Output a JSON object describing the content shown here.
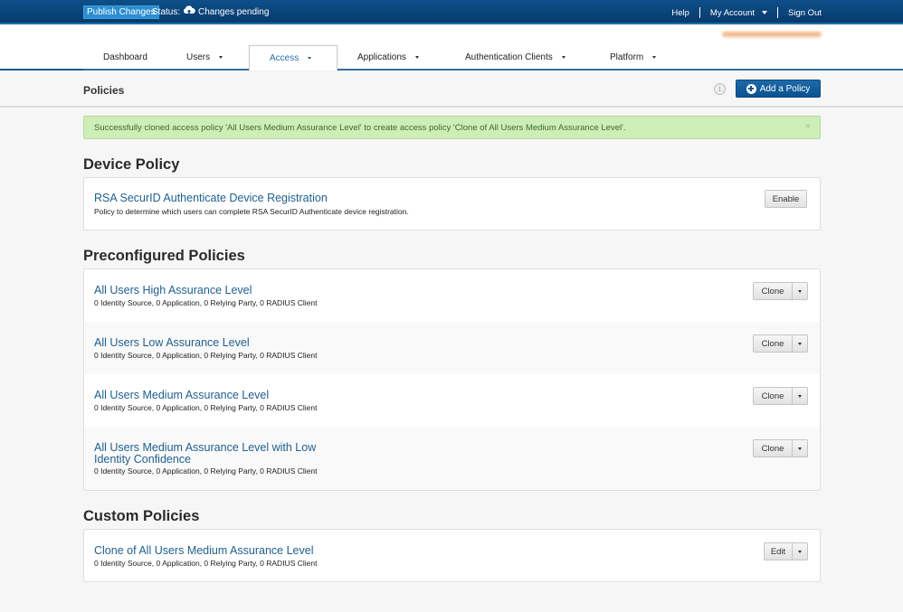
{
  "topbar": {
    "publish_label": "Publish Changes",
    "status_label": "Status:",
    "status_icon": "cloud-upload-icon",
    "status_text": "Changes pending",
    "links": {
      "help": "Help",
      "my_account": "My Account",
      "sign_out": "Sign Out"
    }
  },
  "nav": {
    "tabs": [
      {
        "label": "Dashboard",
        "has_dropdown": false
      },
      {
        "label": "Users",
        "has_dropdown": true
      },
      {
        "label": "Access",
        "has_dropdown": true,
        "active": true
      },
      {
        "label": "Applications",
        "has_dropdown": true
      },
      {
        "label": "Authentication Clients",
        "has_dropdown": true
      },
      {
        "label": "Platform",
        "has_dropdown": true
      }
    ]
  },
  "subheader": {
    "title": "Policies",
    "info_icon": "i",
    "add_button": "Add a Policy"
  },
  "alert": {
    "message": "Successfully cloned access policy 'All Users Medium Assurance Level' to create access policy 'Clone of All Users Medium Assurance Level'.",
    "close": "×"
  },
  "sections": {
    "device": {
      "title": "Device Policy",
      "items": [
        {
          "name": "RSA SecurID Authenticate Device Registration",
          "description": "Policy to determine which users can complete RSA SecurID Authenticate device registration.",
          "action": "Enable"
        }
      ]
    },
    "preconfigured": {
      "title": "Preconfigured Policies",
      "items": [
        {
          "name": "All Users High Assurance Level",
          "description": "0 Identity Source, 0 Application, 0 Relying Party, 0 RADIUS Client",
          "action": "Clone"
        },
        {
          "name": "All Users Low Assurance Level",
          "description": "0 Identity Source, 0 Application, 0 Relying Party, 0 RADIUS Client",
          "action": "Clone"
        },
        {
          "name": "All Users Medium Assurance Level",
          "description": "0 Identity Source, 0 Application, 0 Relying Party, 0 RADIUS Client",
          "action": "Clone"
        },
        {
          "name": "All Users Medium Assurance Level with Low Identity Confidence",
          "description": "0 Identity Source, 0 Application, 0 Relying Party, 0 RADIUS Client",
          "action": "Clone"
        }
      ]
    },
    "custom": {
      "title": "Custom Policies",
      "items": [
        {
          "name": "Clone of All Users Medium Assurance Level",
          "description": "0 Identity Source, 0 Application, 0 Relying Party, 0 RADIUS Client",
          "action": "Edit"
        }
      ]
    }
  },
  "colors": {
    "topbar": "#0a4378",
    "primary_button": "#0c5290",
    "link": "#1f5f8e",
    "alert_bg": "#cdeeb6",
    "alert_text": "#3d6b2a"
  }
}
